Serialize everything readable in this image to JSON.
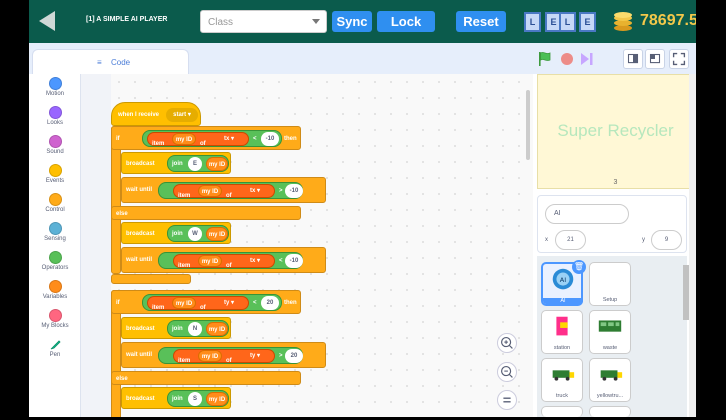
{
  "header": {
    "project_title": "[1] A SIMPLE AI PLAYER",
    "class_placeholder": "Class",
    "sync_label": "Sync",
    "lock_label": "Lock",
    "reset_label": "Reset",
    "level_boxes": [
      "L",
      "E",
      "L",
      "E"
    ],
    "coins": "78697.5"
  },
  "tabs": {
    "code_label": "Code"
  },
  "palette": {
    "categories": [
      {
        "label": "Motion",
        "color": "#4c97ff"
      },
      {
        "label": "Looks",
        "color": "#9966ff"
      },
      {
        "label": "Sound",
        "color": "#cf63cf"
      },
      {
        "label": "Events",
        "color": "#ffbf00"
      },
      {
        "label": "Control",
        "color": "#ffab19"
      },
      {
        "label": "Sensing",
        "color": "#5cb1d6"
      },
      {
        "label": "Operators",
        "color": "#59c059"
      },
      {
        "label": "Variables",
        "color": "#ff8c1a"
      },
      {
        "label": "My Blocks",
        "color": "#ff6680"
      },
      {
        "label": "Pen",
        "color": "#0fbd8c"
      }
    ]
  },
  "script": {
    "hat": {
      "text": "when I receive",
      "message": "start"
    },
    "if1": {
      "if": "if",
      "then": "then",
      "item": "item",
      "myid": "my ID",
      "of": "of",
      "list": "tx",
      "op": "<",
      "value": "-10"
    },
    "bc1": {
      "broadcast": "broadcast",
      "join": "join",
      "letter": "E",
      "myid": "my ID"
    },
    "wait1": {
      "wait": "wait until",
      "item": "item",
      "myid": "my ID",
      "of": "of",
      "list": "tx",
      "op": ">",
      "value": "-10"
    },
    "else1": "else",
    "bc2": {
      "broadcast": "broadcast",
      "join": "join",
      "letter": "W",
      "myid": "my ID"
    },
    "wait2": {
      "wait": "wait until",
      "item": "item",
      "myid": "my ID",
      "of": "of",
      "list": "tx",
      "op": "<",
      "value": "-10"
    },
    "if2": {
      "if": "if",
      "then": "then",
      "item": "item",
      "myid": "my ID",
      "of": "of",
      "list": "ty",
      "op": "<",
      "value": "20"
    },
    "bc3": {
      "broadcast": "broadcast",
      "join": "join",
      "letter": "N",
      "myid": "my ID"
    },
    "wait3": {
      "wait": "wait until",
      "item": "item",
      "myid": "my ID",
      "of": "of",
      "list": "ty",
      "op": ">",
      "value": "20"
    },
    "else2": "else",
    "bc4": {
      "broadcast": "broadcast",
      "join": "join",
      "letter": "S",
      "myid": "my ID"
    }
  },
  "zoom": {
    "zoom_in": "+",
    "zoom_out": "−",
    "reset": "="
  },
  "stage": {
    "title": "Super Recycler",
    "number": "3"
  },
  "sprite_info": {
    "name": "AI",
    "x_label": "x",
    "x": "21",
    "y_label": "y",
    "y": "9"
  },
  "sprites": [
    {
      "name": "AI",
      "selected": true
    },
    {
      "name": "Setup",
      "selected": false
    },
    {
      "name": "station",
      "selected": false
    },
    {
      "name": "waste",
      "selected": false
    },
    {
      "name": "truck",
      "selected": false
    },
    {
      "name": "yellowtru...",
      "selected": false
    }
  ],
  "colors": {
    "topbar": "#0b5b4c",
    "button": "#2f8ff0",
    "coins": "#f4c84a",
    "control": "#ffab19",
    "operator": "#59c059",
    "variable": "#ff8c1a"
  },
  "icons": [
    "back-arrow-icon",
    "coin-icon",
    "code-icon",
    "green-flag-icon",
    "stop-icon",
    "turbo-icon",
    "small-stage-icon",
    "normal-stage-icon",
    "fullscreen-icon",
    "zoom-in-icon",
    "zoom-out-icon",
    "zoom-reset-icon",
    "delete-sprite-icon"
  ]
}
